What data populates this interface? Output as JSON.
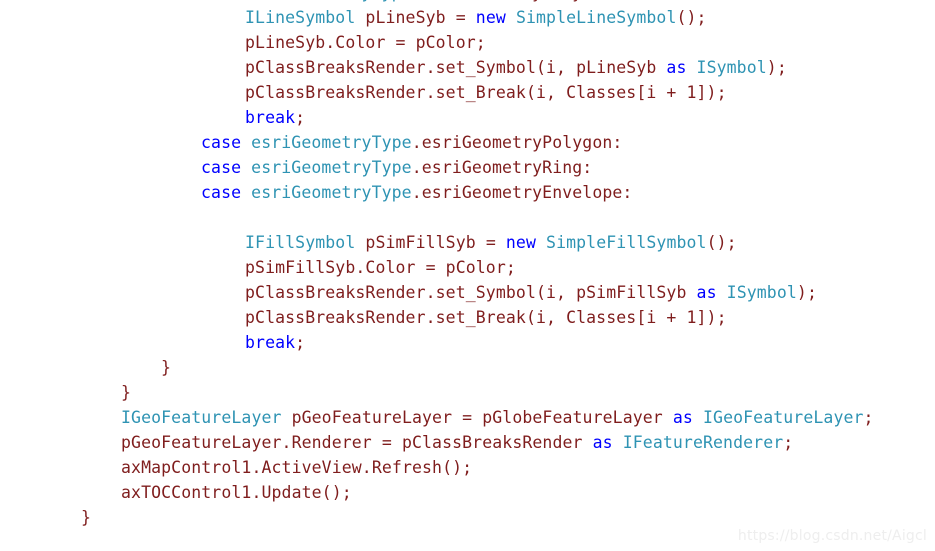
{
  "editor": {
    "background_color": "#ffffff",
    "language": "csharp",
    "syntax_colors": {
      "plain": "#7f1d1d",
      "keyword": "#0000ff",
      "type": "#2e93b3",
      "punctuation": "#7f1d1d"
    },
    "lines": [
      {
        "indent": 160,
        "tokens": [
          {
            "text": "case ",
            "kind": "keyword"
          },
          {
            "text": "esriGeometryType",
            "kind": "type"
          },
          {
            "text": ".esriGeometryPolyline:",
            "kind": "plain"
          }
        ]
      },
      {
        "indent": 204,
        "tokens": [
          {
            "text": "ILineSymbol",
            "kind": "type"
          },
          {
            "text": " pLineSyb = ",
            "kind": "plain"
          },
          {
            "text": "new",
            "kind": "keyword"
          },
          {
            "text": " ",
            "kind": "plain"
          },
          {
            "text": "SimpleLineSymbol",
            "kind": "type"
          },
          {
            "text": "();",
            "kind": "plain"
          }
        ]
      },
      {
        "indent": 204,
        "tokens": [
          {
            "text": "pLineSyb.Color = pColor;",
            "kind": "plain"
          }
        ]
      },
      {
        "indent": 204,
        "tokens": [
          {
            "text": "pClassBreaksRender.set_Symbol(i, pLineSyb ",
            "kind": "plain"
          },
          {
            "text": "as",
            "kind": "keyword"
          },
          {
            "text": " ",
            "kind": "plain"
          },
          {
            "text": "ISymbol",
            "kind": "type"
          },
          {
            "text": ");",
            "kind": "plain"
          }
        ]
      },
      {
        "indent": 204,
        "tokens": [
          {
            "text": "pClassBreaksRender.set_Break(i, Classes[i + 1]);",
            "kind": "plain"
          }
        ]
      },
      {
        "indent": 204,
        "tokens": [
          {
            "text": "break",
            "kind": "keyword"
          },
          {
            "text": ";",
            "kind": "plain"
          }
        ]
      },
      {
        "indent": 160,
        "tokens": [
          {
            "text": "case ",
            "kind": "keyword"
          },
          {
            "text": "esriGeometryType",
            "kind": "type"
          },
          {
            "text": ".esriGeometryPolygon:",
            "kind": "plain"
          }
        ]
      },
      {
        "indent": 160,
        "tokens": [
          {
            "text": "case ",
            "kind": "keyword"
          },
          {
            "text": "esriGeometryType",
            "kind": "type"
          },
          {
            "text": ".esriGeometryRing:",
            "kind": "plain"
          }
        ]
      },
      {
        "indent": 160,
        "tokens": [
          {
            "text": "case ",
            "kind": "keyword"
          },
          {
            "text": "esriGeometryType",
            "kind": "type"
          },
          {
            "text": ".esriGeometryEnvelope:",
            "kind": "plain"
          }
        ]
      },
      {
        "indent": 0,
        "tokens": []
      },
      {
        "indent": 204,
        "tokens": [
          {
            "text": "IFillSymbol",
            "kind": "type"
          },
          {
            "text": " pSimFillSyb = ",
            "kind": "plain"
          },
          {
            "text": "new",
            "kind": "keyword"
          },
          {
            "text": " ",
            "kind": "plain"
          },
          {
            "text": "SimpleFillSymbol",
            "kind": "type"
          },
          {
            "text": "();",
            "kind": "plain"
          }
        ]
      },
      {
        "indent": 204,
        "tokens": [
          {
            "text": "pSimFillSyb.Color = pColor;",
            "kind": "plain"
          }
        ]
      },
      {
        "indent": 204,
        "tokens": [
          {
            "text": "pClassBreaksRender.set_Symbol(i, pSimFillSyb ",
            "kind": "plain"
          },
          {
            "text": "as",
            "kind": "keyword"
          },
          {
            "text": " ",
            "kind": "plain"
          },
          {
            "text": "ISymbol",
            "kind": "type"
          },
          {
            "text": ");",
            "kind": "plain"
          }
        ]
      },
      {
        "indent": 204,
        "tokens": [
          {
            "text": "pClassBreaksRender.set_Break(i, Classes[i + 1]);",
            "kind": "plain"
          }
        ]
      },
      {
        "indent": 204,
        "tokens": [
          {
            "text": "break",
            "kind": "keyword"
          },
          {
            "text": ";",
            "kind": "plain"
          }
        ]
      },
      {
        "indent": 120,
        "tokens": [
          {
            "text": "}",
            "kind": "punct"
          }
        ]
      },
      {
        "indent": 80,
        "tokens": [
          {
            "text": "}",
            "kind": "punct"
          }
        ]
      },
      {
        "indent": 80,
        "tokens": [
          {
            "text": "IGeoFeatureLayer",
            "kind": "type"
          },
          {
            "text": " pGeoFeatureLayer = pGlobeFeatureLayer ",
            "kind": "plain"
          },
          {
            "text": "as",
            "kind": "keyword"
          },
          {
            "text": " ",
            "kind": "plain"
          },
          {
            "text": "IGeoFeatureLayer",
            "kind": "type"
          },
          {
            "text": ";",
            "kind": "plain"
          }
        ]
      },
      {
        "indent": 80,
        "tokens": [
          {
            "text": "pGeoFeatureLayer.Renderer = pClassBreaksRender ",
            "kind": "plain"
          },
          {
            "text": "as",
            "kind": "keyword"
          },
          {
            "text": " ",
            "kind": "plain"
          },
          {
            "text": "IFeatureRenderer",
            "kind": "type"
          },
          {
            "text": ";",
            "kind": "plain"
          }
        ]
      },
      {
        "indent": 80,
        "tokens": [
          {
            "text": "axMapControl1.ActiveView.Refresh();",
            "kind": "plain"
          }
        ]
      },
      {
        "indent": 80,
        "tokens": [
          {
            "text": "axTOCControl1.Update();",
            "kind": "plain"
          }
        ]
      },
      {
        "indent": 40,
        "tokens": [
          {
            "text": "}",
            "kind": "punct"
          }
        ]
      }
    ]
  },
  "watermark": {
    "text": "https://blog.csdn.net/Aigcl",
    "color": "#eeeeee"
  }
}
